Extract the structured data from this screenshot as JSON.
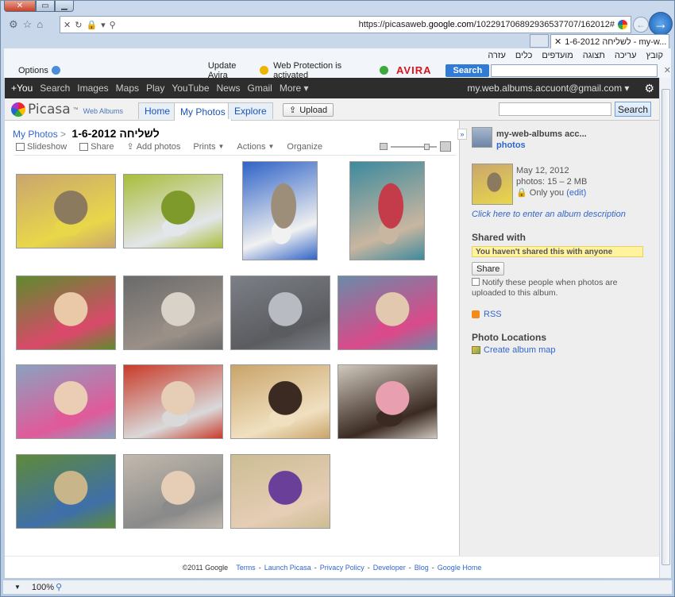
{
  "browser": {
    "url_prefix": "https://picasaweb.",
    "url_domain": "google.com",
    "url_suffix": "/102291706892936537707/162012#",
    "tab_title": "1-6-2012 לשליחה - my-w...",
    "menu": [
      "קובץ",
      "עריכה",
      "תצוגה",
      "מועדפים",
      "כלים",
      "עזרה"
    ],
    "zoom": "100%"
  },
  "avira": {
    "options": "Options",
    "update": "Update Avira",
    "protection": "Web Protection is activated",
    "logo": "AVIRA",
    "search_btn": "Search"
  },
  "gbar": {
    "items": [
      "+You",
      "Search",
      "Images",
      "Maps",
      "Play",
      "YouTube",
      "News",
      "Gmail",
      "More ▾"
    ],
    "account": "my.web.albums.accuont@gmail.com ▾"
  },
  "picasa": {
    "logo": "Picasa",
    "logo_tm": "™",
    "logo_sub": "Web Albums",
    "tabs": [
      "Home",
      "My Photos",
      "Explore"
    ],
    "upload": "Upload",
    "search_btn": "Search"
  },
  "album": {
    "crumb": "My Photos",
    "crumb_sep": ">",
    "title": "1-6-2012 לשליחה",
    "actions": {
      "slideshow": "Slideshow",
      "share": "Share",
      "add": "Add photos",
      "prints": "Prints",
      "actions": "Actions",
      "organize": "Organize"
    }
  },
  "sidebar": {
    "owner": "my-web-albums acc...",
    "photos_link": "photos",
    "date": "May 12, 2012",
    "photos_count": "photos: 15 – 2 MB",
    "visibility": "Only you",
    "edit": "(edit)",
    "desc_link": "Click here to enter an album description",
    "shared_with": "Shared with",
    "not_shared": "You haven't shared this with anyone",
    "share_btn": "Share",
    "notify": "Notify these people when photos are uploaded to this album.",
    "rss": "RSS",
    "locations": "Photo Locations",
    "create_map": "Create album map"
  },
  "footer": {
    "copyright": "©2011 Google",
    "links": [
      "Terms",
      "Launch Picasa",
      "Privacy Policy",
      "Developer",
      "Blog",
      "Google Home"
    ],
    "sep": "-"
  },
  "photos": [
    {
      "name": "photo-girl-inflatable-ring",
      "c1": "#c9a66e",
      "c2": "#8c7a5e",
      "c3": "#e9d74a"
    },
    {
      "name": "photo-girl-in-pool",
      "c1": "#a9bd3a",
      "c2": "#7d9a2a",
      "c3": "#e3e6ea"
    },
    {
      "name": "photo-girl-blue-chair",
      "c1": "#2f63c7",
      "c2": "#9c8e78",
      "c3": "#f1f1f1"
    },
    {
      "name": "photo-girl-red-shirt",
      "c1": "#3d8a9d",
      "c2": "#c43b4a",
      "c3": "#c9b6a0"
    },
    {
      "name": "photo-girl-closeup-garden",
      "c1": "#5f8a2e",
      "c2": "#e9c9a8",
      "c3": "#d94a6a"
    },
    {
      "name": "photo-girl-walking-patio",
      "c1": "#6a6a6a",
      "c2": "#d9d2c8",
      "c3": "#9a9088"
    },
    {
      "name": "photo-girl-parking-lot",
      "c1": "#7c7f86",
      "c2": "#b8bcc2",
      "c3": "#5a5c60"
    },
    {
      "name": "photo-girl-pink-glasses-store",
      "c1": "#6b8aa8",
      "c2": "#e3c8b0",
      "c3": "#d94a8a"
    },
    {
      "name": "photo-girl-pink-glasses-closeup",
      "c1": "#8aa2c0",
      "c2": "#ebcdb5",
      "c3": "#e05a9a"
    },
    {
      "name": "photo-girl-red-chair",
      "c1": "#c93b2a",
      "c2": "#e6cdb5",
      "c3": "#d9d9d9"
    },
    {
      "name": "photo-birthday-cake-table",
      "c1": "#c9a46a",
      "c2": "#3a2a22",
      "c3": "#f0e0c0"
    },
    {
      "name": "photo-girl-cake-plate",
      "c1": "#cfc8bd",
      "c2": "#e8a0b0",
      "c3": "#3a2a22"
    },
    {
      "name": "photo-hammock-garden",
      "c1": "#5f8a3a",
      "c2": "#c9b58a",
      "c3": "#3f6fa8"
    },
    {
      "name": "photo-children-group",
      "c1": "#c2b9ad",
      "c2": "#e6cdb5",
      "c3": "#8a8a8a"
    },
    {
      "name": "photo-girl-purple-dress",
      "c1": "#cbbd93",
      "c2": "#6a3f9a",
      "c3": "#e6cdb5"
    }
  ]
}
